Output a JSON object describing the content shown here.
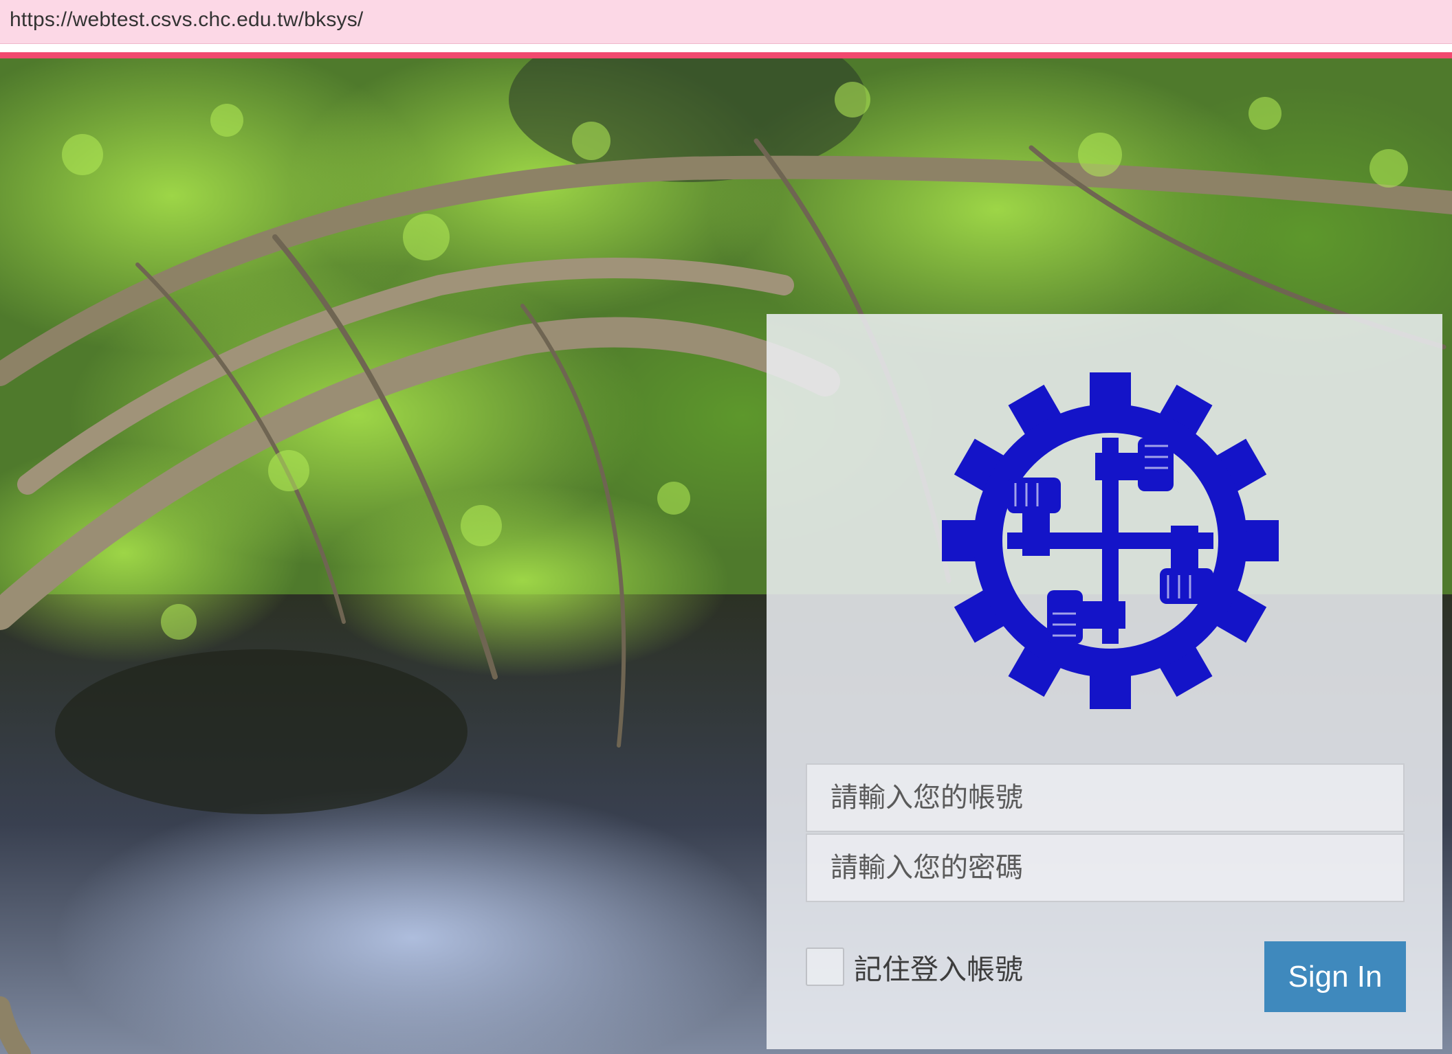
{
  "browser": {
    "url": "https://webtest.csvs.chc.edu.tw/bksys/"
  },
  "login": {
    "username_placeholder": "請輸入您的帳號",
    "username_value": "",
    "password_placeholder": "請輸入您的密碼",
    "password_value": "",
    "remember_label": "記住登入帳號",
    "remember_checked": false,
    "signin_label": "Sign In"
  },
  "icons": {
    "toolbar_extension": "shield-extension-icon",
    "logo": "gear-hands-school-logo"
  },
  "colors": {
    "urlbar_bg": "#fcd8e6",
    "accent": "#f1496f",
    "logo_blue": "#1414c8",
    "signin_bg": "#3f89bd"
  }
}
